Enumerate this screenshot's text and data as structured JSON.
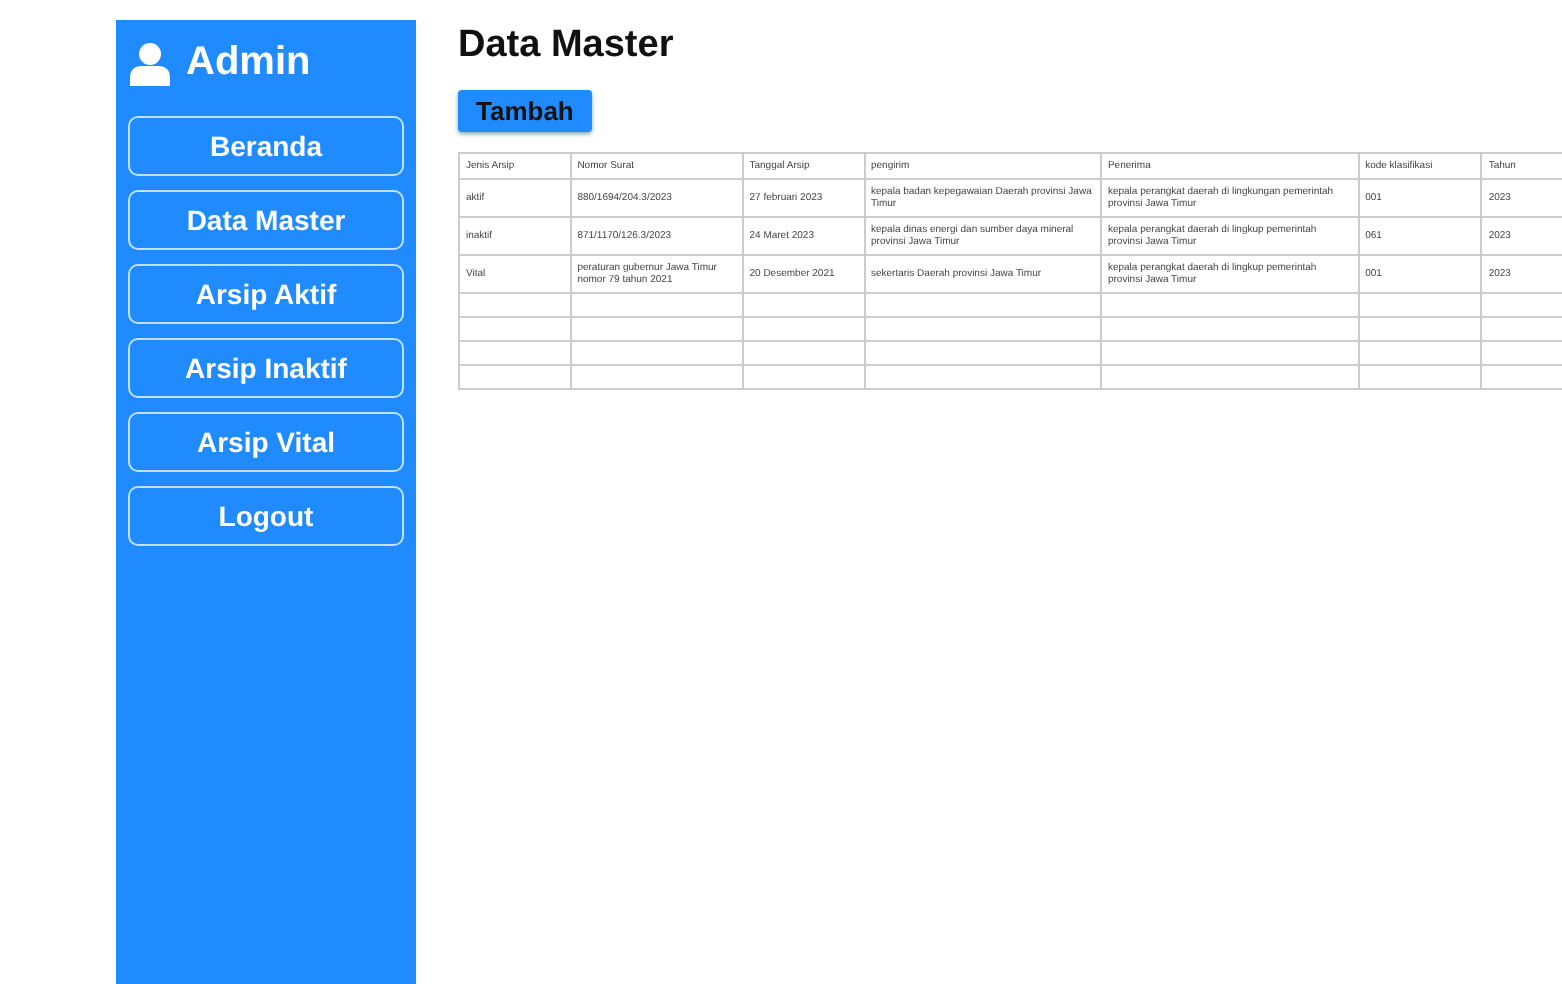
{
  "sidebar": {
    "title": "Admin",
    "items": [
      {
        "label": "Beranda"
      },
      {
        "label": "Data Master"
      },
      {
        "label": "Arsip Aktif"
      },
      {
        "label": "Arsip Inaktif"
      },
      {
        "label": "Arsip Vital"
      },
      {
        "label": "Logout"
      }
    ]
  },
  "page_title": "Data Master",
  "add_button": "Tambah",
  "table": {
    "columns": [
      "Jenis Arsip",
      "Nomor Surat",
      "Tanggal Arsip",
      "pengirim",
      "Penerima",
      "kode klasifikasi",
      "Tahun"
    ],
    "rows": [
      [
        "aktif",
        "880/1694/204.3/2023",
        "27 februari 2023",
        "kepala badan kepegawaian Daerah provinsi Jawa Timur",
        "kepala perangkat daerah di lingkungan pemerintah provinsi Jawa Timur",
        "001",
        "2023"
      ],
      [
        "inaktif",
        "871/1170/126.3/2023",
        "24 Maret 2023",
        "kepala dinas energi dan sumber daya mineral provinsi Jawa Timur",
        "kepala perangkat daerah di lingkup pemerintah provinsi Jawa Timur",
        "061",
        "2023"
      ],
      [
        "Vital",
        "peraturan gubernur Jawa Timur nomor 79 tahun 2021",
        "20 Desember 2021",
        "sekertaris Daerah provinsi Jawa Timur",
        "kepala perangkat daerah di lingkup pemerintah provinsi Jawa Timur",
        "001",
        "2023"
      ]
    ]
  }
}
